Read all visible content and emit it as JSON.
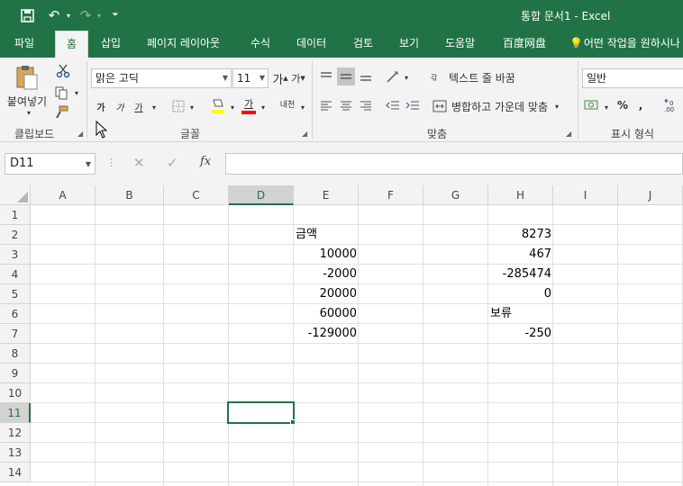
{
  "titlebar": {
    "title": "통합 문서1  -  Excel",
    "save_icon": "save-icon",
    "undo_icon": "undo-icon",
    "redo_icon": "redo-icon"
  },
  "tabs": [
    "파일",
    "홈",
    "삽입",
    "페이지 레이아웃",
    "수식",
    "데이터",
    "검토",
    "보기",
    "도움말",
    "百度网盘",
    "어떤 작업을 원하시나"
  ],
  "active_tab": 1,
  "ribbon": {
    "clipboard": {
      "paste": "붙여넣기",
      "label": "클립보드"
    },
    "font": {
      "name": "맑은 고딕",
      "size": "11",
      "grow": "가",
      "shrink": "가",
      "bold": "가",
      "italic": "가",
      "underline": "가",
      "font_color_glyph": "가",
      "phonetic": "내천",
      "label": "글꼴",
      "highlight_color": "#ffff00",
      "font_color": "#ff0000"
    },
    "alignment": {
      "wrap": "텍스트 줄 바꿈",
      "merge": "병합하고 가운데 맞춤",
      "wrap_glyph": "갂",
      "label": "맞춤"
    },
    "number": {
      "format": "일반",
      "percent": "%",
      "comma": ",",
      "label": "표시 형식"
    }
  },
  "formula_bar": {
    "name_box": "D11",
    "cancel": "✕",
    "enter": "✓",
    "fx": "fx",
    "value": ""
  },
  "sheet": {
    "columns": [
      "A",
      "B",
      "C",
      "D",
      "E",
      "F",
      "G",
      "H",
      "I",
      "J"
    ],
    "rows": [
      "1",
      "2",
      "3",
      "4",
      "5",
      "6",
      "7",
      "8",
      "9",
      "10",
      "11",
      "12",
      "13",
      "14"
    ],
    "selected_cell": "D11",
    "grid_color": "#e1e1e1",
    "accent_color": "#217346",
    "cells": {
      "E2": "금액",
      "E3": "10000",
      "E4": "-2000",
      "E5": "20000",
      "E6": "60000",
      "E7": "-129000",
      "H2": "8273",
      "H3": "467",
      "H4": "-285474",
      "H5": "0",
      "H6": "보류",
      "H7": "-250"
    }
  }
}
